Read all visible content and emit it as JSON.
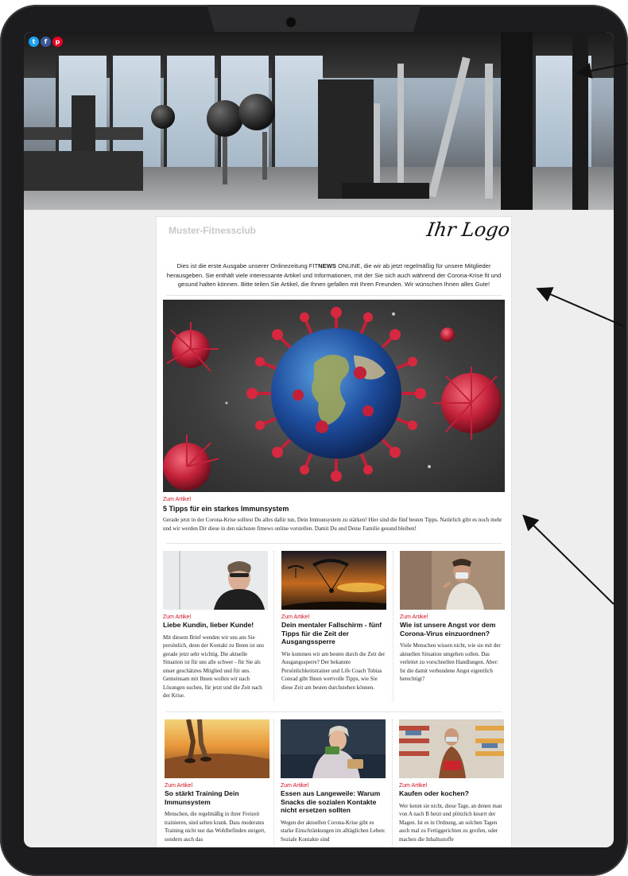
{
  "social": {
    "icons": [
      {
        "name": "twitter-icon",
        "glyph": "t",
        "color": "#1da1f2"
      },
      {
        "name": "facebook-icon",
        "glyph": "f",
        "color": "#3b5998"
      },
      {
        "name": "pinterest-icon",
        "glyph": "p",
        "color": "#e60023"
      }
    ]
  },
  "newsletter": {
    "club_name": "Muster-Fitnessclub",
    "logo_text": "Ihr Logo",
    "intro_part1": "Dies ist die erste Ausgabe unserer Onlinezeitung FIT",
    "intro_bold": "NEWS",
    "intro_part2": " ONLINE, die wir ab jetzt regelmäßig für unsere Mitglieder herausgeben. Sie enthält viele interessante Artikel und Informationen, mit der Sie sich auch während der Corona-Krise fit und gesund halten können. Bitte teilen Sie Artikel, die Ihnen gefallen mit Ihren Freunden. Wir wünschen Ihnen alles Gute!"
  },
  "feature": {
    "kicker": "Zum Artikel",
    "headline": "5 Tipps für ein starkes Immunsystem",
    "body": "Gerade jetzt in der Corona-Krise solltest Du alles dafür tun, Dein Immunsystem zu stärken! Hier sind die fünf besten Tipps. Natürlich gibt es noch mehr und wir werden Dir diese in den nächsten fitnews online vorstellen. Damit Du und Deine Familie gesund bleiben!"
  },
  "articles": [
    {
      "kicker": "Zum Artikel",
      "headline": "Liebe Kundin, lieber Kunde!",
      "body": "Mit diesem Brief wenden wir uns ans Sie persönlich, denn der Kontakt zu Ihnen ist uns gerade jetzt sehr wichtig. Die aktuelle Situation ist für uns alle schwer - für Sie als unser geschätztes Mitglied und für uns. Gemeinsam mit Ihnen wollen wir nach Lösungen suchen, für jetzt und die Zeit nach der Krise."
    },
    {
      "kicker": "Zum Artikel",
      "headline": "Dein mentaler Fallschirm - fünf Tipps für die Zeit der Ausgangssperre",
      "body": "Wie kommen wir am besten durch die Zeit der Ausgangssperre? Der bekannte Persönlichkeitstrainer und Life Coach Tobias Conrad gibt Ihnen wertvolle Tipps, wie Sie diese Zeit am besten durchstehen können."
    },
    {
      "kicker": "Zum Artikel",
      "headline": "Wie ist unsere Angst vor dem Corona-Virus einzuordnen?",
      "body": "Viele Menschen wissen nicht, wie sie mit der aktuellen Situation umgehen sollen. Das verleitet zu vorschnellen Handlungen. Aber: Ist die damit verbundene Angst eigentlich berechtigt?"
    },
    {
      "kicker": "Zum Artikel",
      "headline": "So stärkt Training Dein Immunsystem",
      "body": "Menschen, die regelmäßig in ihrer Freizeit trainieren, sind selten krank. Dass moderates Training nicht nur das Wohlbefinden steigert, sondern auch das"
    },
    {
      "kicker": "Zum Artikel",
      "headline": "Essen aus Langeweile: Warum Snacks die sozialen Kontakte nicht ersetzen sollten",
      "body": "Wegen der aktuellen Corona-Krise gibt es starke Einschränkungen im alltäglichen Leben: Soziale Kontakte sind"
    },
    {
      "kicker": "Zum Artikel",
      "headline": "Kaufen oder kochen?",
      "body": "Wer kennt sie nicht, diese Tage, an denen man von A nach B hetzt und plötzlich knurrt der Magen. Ist es in Ordnung, an solchen Tagen auch mal zu Fertiggerichten zu greifen, oder machen die Inhaltsstoffe"
    }
  ]
}
